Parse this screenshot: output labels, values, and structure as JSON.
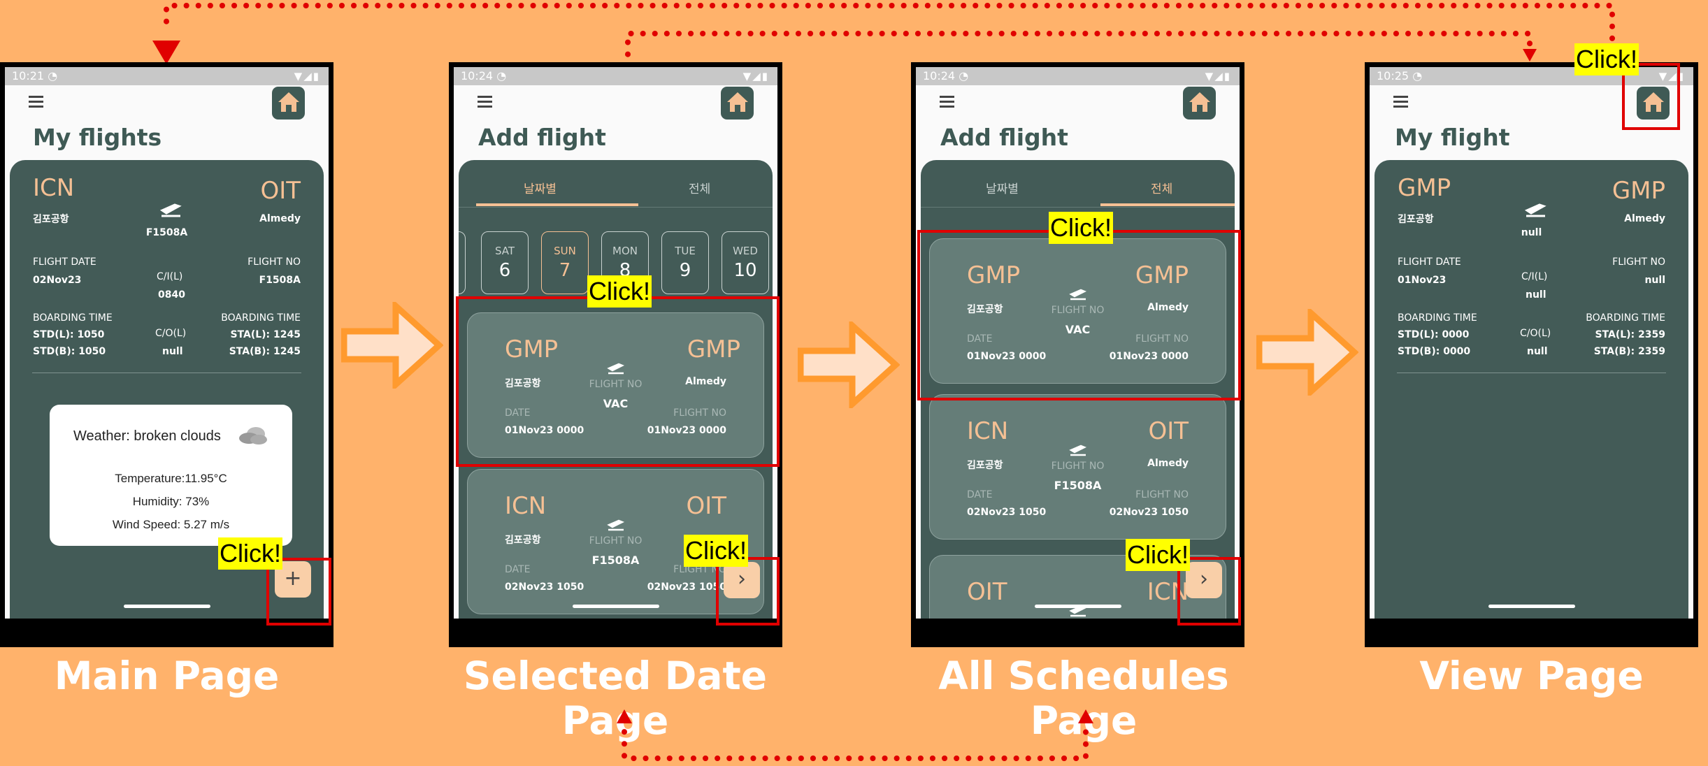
{
  "colors": {
    "background": "#FFB26B",
    "panel": "#435b57",
    "card": "#657d78",
    "accent": "#F5C094",
    "click": "#FFFF00",
    "highlight": "#e00000"
  },
  "click_label": "Click!",
  "main": {
    "time": "10:21",
    "title": "My flights",
    "from_code": "ICN",
    "from_name": "김포공항",
    "to_code": "OIT",
    "to_name": "Almedy",
    "center_no": "F1508A",
    "flight_date_label": "FLIGHT DATE",
    "flight_date": "02Nov23",
    "ci_label": "C/I(L)",
    "ci_value": "0840",
    "flight_no_label": "FLIGHT NO",
    "flight_no": "F1508A",
    "boarding_label": "BOARDING TIME",
    "co_label": "C/O(L)",
    "co_value": "null",
    "std_l": "STD(L): 1050",
    "std_b": "STD(B): 1050",
    "sta_l": "STA(L): 1245",
    "sta_b": "STA(B): 1245",
    "weather_title": "Weather: broken clouds",
    "temperature": "Temperature:11.95°C",
    "humidity": "Humidity: 73%",
    "wind": "Wind Speed: 5.27 m/s",
    "fab": "+",
    "caption": "Main Page"
  },
  "selected": {
    "time": "10:24",
    "title": "Add flight",
    "tab1": "날짜별",
    "tab2": "전체",
    "days": [
      {
        "n": "SAT",
        "d": "6"
      },
      {
        "n": "SUN",
        "d": "7"
      },
      {
        "n": "MON",
        "d": "8"
      },
      {
        "n": "TUE",
        "d": "9"
      },
      {
        "n": "WED",
        "d": "10"
      }
    ],
    "cards": [
      {
        "from": "GMP",
        "from_name": "김포공항",
        "to": "GMP",
        "to_name": "Almedy",
        "fn_label": "FLIGHT NO",
        "fn": "VAC",
        "date_label": "DATE",
        "date": "01Nov23 0000",
        "fn_label2": "FLIGHT NO",
        "date2": "01Nov23 0000"
      },
      {
        "from": "ICN",
        "from_name": "김포공항",
        "to": "OIT",
        "to_name": "",
        "fn_label": "FLIGHT NO",
        "fn": "F1508A",
        "date_label": "DATE",
        "date": "02Nov23 1050",
        "fn_label2": "FLIGHT NO",
        "date2": "02Nov23 1050"
      }
    ],
    "caption": "Selected Date Page"
  },
  "all": {
    "time": "10:24",
    "title": "Add flight",
    "tab1": "날짜별",
    "tab2": "전체",
    "cards": [
      {
        "from": "GMP",
        "from_name": "김포공항",
        "to": "GMP",
        "to_name": "Almedy",
        "fn_label": "FLIGHT NO",
        "fn": "VAC",
        "date_label": "DATE",
        "date": "01Nov23 0000",
        "fn_label2": "FLIGHT NO",
        "date2": "01Nov23 0000"
      },
      {
        "from": "ICN",
        "from_name": "김포공항",
        "to": "OIT",
        "to_name": "Almedy",
        "fn_label": "FLIGHT NO",
        "fn": "F1508A",
        "date_label": "DATE",
        "date": "02Nov23 1050",
        "fn_label2": "FLIGHT NO",
        "date2": "02Nov23 1050"
      },
      {
        "from": "OIT",
        "to": "ICN"
      }
    ],
    "caption": "All Schedules Page"
  },
  "view": {
    "time": "10:25",
    "title": "My flight",
    "from_code": "GMP",
    "from_name": "김포공항",
    "to_code": "GMP",
    "to_name": "Almedy",
    "center_no": "null",
    "flight_date_label": "FLIGHT DATE",
    "flight_date": "01Nov23",
    "ci_label": "C/I(L)",
    "ci_value": "null",
    "flight_no_label": "FLIGHT NO",
    "flight_no": "null",
    "boarding_label": "BOARDING TIME",
    "co_label": "C/O(L)",
    "co_value": "null",
    "std_l": "STD(L): 0000",
    "std_b": "STD(B): 0000",
    "sta_l": "STA(L): 2359",
    "sta_b": "STA(B): 2359",
    "caption": "View Page"
  }
}
